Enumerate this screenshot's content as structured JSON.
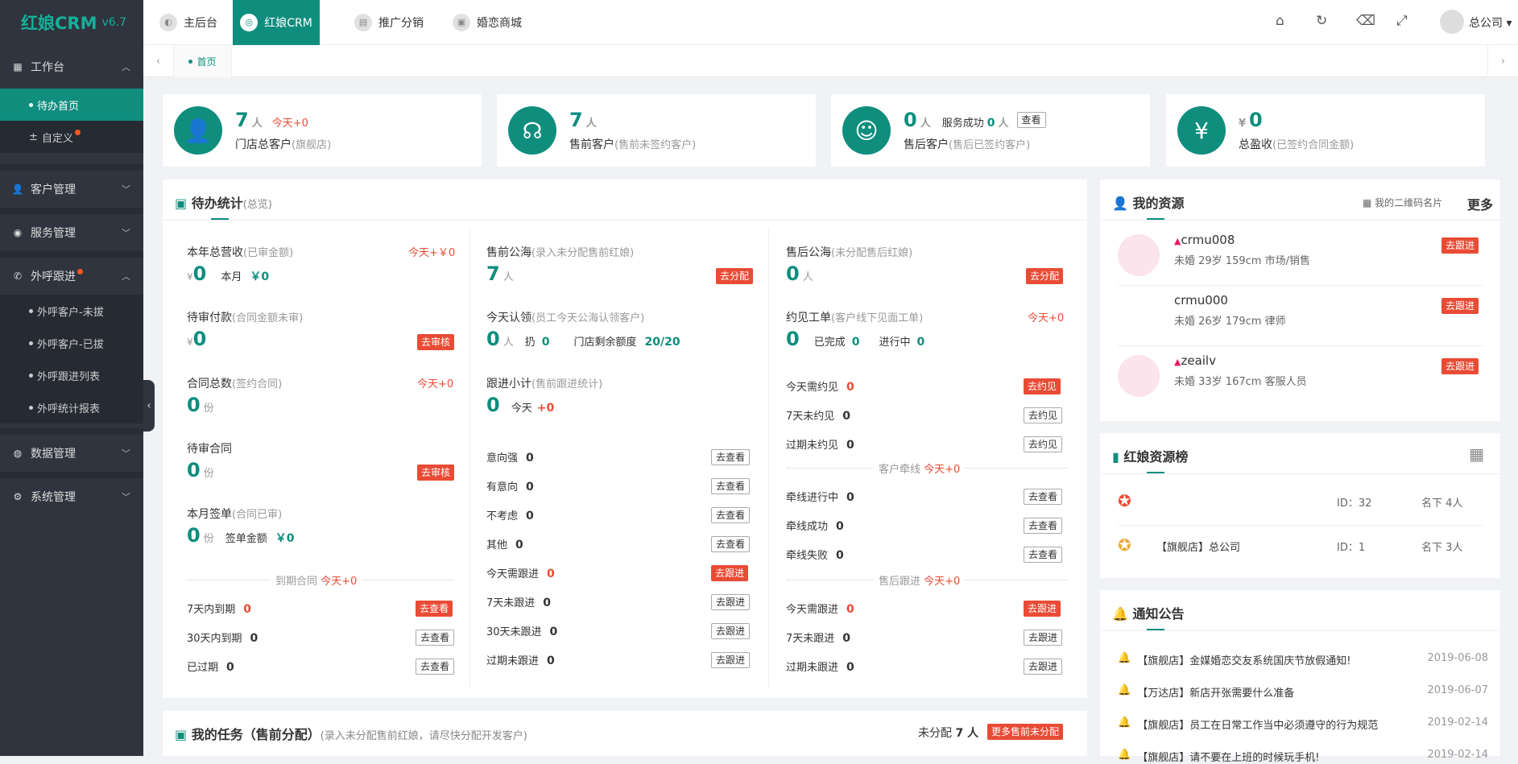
{
  "app": {
    "logo": "红娘CRM",
    "version": "v6.7"
  },
  "sidebar": {
    "workbench": "工作台",
    "workbench_items": [
      "待办首页",
      "自定义"
    ],
    "customers": "客户管理",
    "service": "服务管理",
    "outbound": "外呼跟进",
    "outbound_items": [
      "外呼客户-未拔",
      "外呼客户-已拔",
      "外呼跟进列表",
      "外呼统计报表"
    ],
    "data": "数据管理",
    "system": "系统管理"
  },
  "header": {
    "tabs": [
      "主后台",
      "红娘CRM",
      "推广分销",
      "婚恋商城"
    ],
    "user": "总公司"
  },
  "breadcrumb": {
    "home": "首页"
  },
  "stats": [
    {
      "num": "7",
      "unit": "人",
      "today": "今天+0",
      "label": "门店总客户",
      "note": "(旗舰店)"
    },
    {
      "num": "7",
      "unit": "人",
      "label": "售前客户",
      "note": "(售前未签约客户)"
    },
    {
      "num": "0",
      "unit": "人",
      "extra": "服务成功",
      "extra_num": "0",
      "extra_unit": "人",
      "btn": "查看",
      "label": "售后客户",
      "note": "(售后已签约客户)"
    },
    {
      "prefix": "¥",
      "num": "0",
      "label": "总盈收",
      "note": "(已签约合同金额)"
    }
  ],
  "todo": {
    "title": "待办统计",
    "title_note": "(总览)",
    "c1": {
      "revenue_label": "本年总营收",
      "revenue_note": "(已审金额)",
      "revenue_today": "今天+￥0",
      "revenue_val": "0",
      "month_label": "本月",
      "month_val": "￥0",
      "pending_pay_label": "待审付款",
      "pending_pay_note": "(合同金额未审)",
      "pending_pay_val": "0",
      "pending_pay_btn": "去审核",
      "contracts_label": "合同总数",
      "contracts_note": "(签约合同)",
      "contracts_today": "今天+0",
      "contracts_val": "0",
      "unit_fen": "份",
      "pending_contract_label": "待审合同",
      "pending_contract_val": "0",
      "pending_contract_btn": "去审核",
      "month_sign_label": "本月签单",
      "month_sign_note": "(合同已审)",
      "month_sign_val": "0",
      "sign_amount_label": "签单金额",
      "sign_amount_val": "￥0",
      "expire_div": "到期合同",
      "expire_today": "今天+0",
      "rows": [
        {
          "label": "7天内到期",
          "val": "0",
          "btn": "去查看"
        },
        {
          "label": "30天内到期",
          "val": "0",
          "btn": "去查看"
        },
        {
          "label": "已过期",
          "val": "0",
          "btn": "去查看"
        }
      ]
    },
    "c2": {
      "pool_label": "售前公海",
      "pool_note": "(录入未分配售前红娘)",
      "pool_val": "7",
      "pool_unit": "人",
      "pool_btn": "去分配",
      "claim_label": "今天认领",
      "claim_note": "(员工今天公海认领客户)",
      "claim_val": "0",
      "claim_unit": "人",
      "throw_label": "扔",
      "throw_val": "0",
      "remain_label": "门店剩余额度",
      "remain_val": "20/20",
      "follow_label": "跟进小计",
      "follow_note": "(售前跟进统计)",
      "follow_val": "0",
      "follow_today_label": "今天",
      "follow_today_val": "+0",
      "rows": [
        {
          "label": "意向强",
          "val": "0",
          "btn": "去查看"
        },
        {
          "label": "有意向",
          "val": "0",
          "btn": "去查看"
        },
        {
          "label": "不考虑",
          "val": "0",
          "btn": "去查看"
        },
        {
          "label": "其他",
          "val": "0",
          "btn": "去查看"
        },
        {
          "label": "今天需跟进",
          "val": "0",
          "btn": "去跟进"
        },
        {
          "label": "7天未跟进",
          "val": "0",
          "btn": "去跟进"
        },
        {
          "label": "30天未跟进",
          "val": "0",
          "btn": "去跟进"
        },
        {
          "label": "过期未跟进",
          "val": "0",
          "btn": "去跟进"
        }
      ]
    },
    "c3": {
      "pool_label": "售后公海",
      "pool_note": "(未分配售后红娘)",
      "pool_val": "0",
      "pool_unit": "人",
      "pool_btn": "去分配",
      "meet_label": "约见工单",
      "meet_note": "(客户线下见面工单)",
      "meet_today": "今天+0",
      "meet_val": "0",
      "done_label": "已完成",
      "done_val": "0",
      "doing_label": "进行中",
      "doing_val": "0",
      "meet_rows": [
        {
          "label": "今天需约见",
          "val": "0",
          "btn": "去约见"
        },
        {
          "label": "7天未约见",
          "val": "0",
          "btn": "去约见"
        },
        {
          "label": "过期未约见",
          "val": "0",
          "btn": "去约见"
        }
      ],
      "pair_div": "客户牵线",
      "pair_today": "今天+0",
      "pair_rows": [
        {
          "label": "牵线进行中",
          "val": "0",
          "btn": "去查看"
        },
        {
          "label": "牵线成功",
          "val": "0",
          "btn": "去查看"
        },
        {
          "label": "牵线失败",
          "val": "0",
          "btn": "去查看"
        }
      ],
      "after_div": "售后跟进",
      "after_today": "今天+0",
      "after_rows": [
        {
          "label": "今天需跟进",
          "val": "0",
          "btn": "去跟进"
        },
        {
          "label": "7天未跟进",
          "val": "0",
          "btn": "去跟进"
        },
        {
          "label": "过期未跟进",
          "val": "0",
          "btn": "去跟进"
        }
      ]
    }
  },
  "resources": {
    "title": "我的资源",
    "qr": "我的二维码名片",
    "more": "更多",
    "items": [
      {
        "name": "crmu008",
        "info": "未婚 29岁 159cm 市场/销售",
        "btn": "去跟进"
      },
      {
        "name": "crmu000",
        "info": "未婚 26岁 179cm 律师",
        "btn": "去跟进"
      },
      {
        "name": "zeailv",
        "info": "未婚 33岁 167cm 客服人员",
        "btn": "去跟进"
      }
    ]
  },
  "ranking": {
    "title": "红娘资源榜",
    "rows": [
      {
        "name": "",
        "id": "ID：32",
        "count": "名下 4人"
      },
      {
        "name": "【旗舰店】总公司",
        "id": "ID：1",
        "count": "名下 3人"
      }
    ]
  },
  "notices": {
    "title": "通知公告",
    "items": [
      {
        "text": "【旗舰店】金媒婚恋交友系统国庆节放假通知!",
        "date": "2019-06-08"
      },
      {
        "text": "【万达店】新店开张需要什么准备",
        "date": "2019-06-07"
      },
      {
        "text": "【旗舰店】员工在日常工作当中必须遵守的行为规范",
        "date": "2019-02-14"
      },
      {
        "text": "【旗舰店】请不要在上班的时候玩手机!",
        "date": "2019-02-14"
      }
    ]
  },
  "tasks": {
    "title": "我的任务（售前分配）",
    "note": "(录入未分配售前红娘，请尽快分配开发客户)",
    "unassigned_label": "未分配",
    "unassigned_val": "7 人",
    "btn": "更多售前未分配"
  }
}
